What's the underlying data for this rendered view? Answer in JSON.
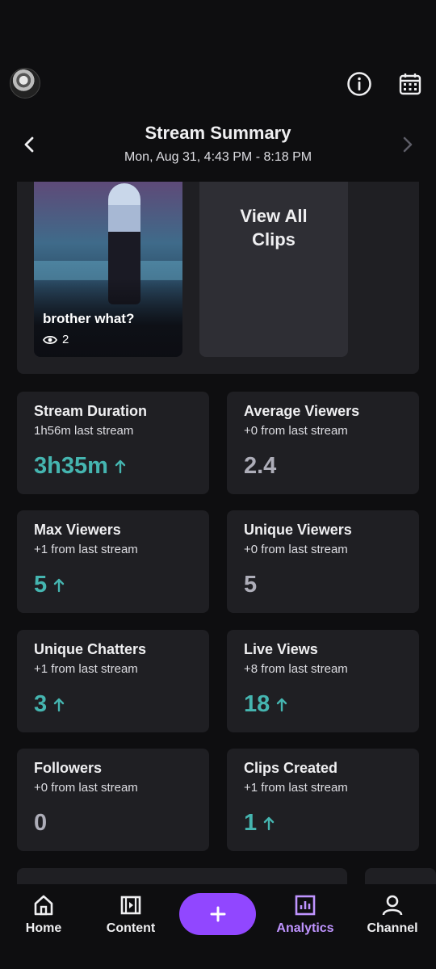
{
  "header": {
    "title": "Stream Summary",
    "subtitle": "Mon, Aug 31, 4:43 PM - 8:18 PM"
  },
  "clips": {
    "items": [
      {
        "title": "brother what?",
        "views": "2"
      }
    ],
    "view_all_label": "View All Clips"
  },
  "stats": [
    {
      "label": "Stream Duration",
      "sub": "1h56m last stream",
      "value": "3h35m",
      "trend": "up"
    },
    {
      "label": "Average Viewers",
      "sub": "+0 from last stream",
      "value": "2.4",
      "trend": "none"
    },
    {
      "label": "Max Viewers",
      "sub": "+1 from last stream",
      "value": "5",
      "trend": "up"
    },
    {
      "label": "Unique Viewers",
      "sub": "+0 from last stream",
      "value": "5",
      "trend": "none"
    },
    {
      "label": "Unique Chatters",
      "sub": "+1 from last stream",
      "value": "3",
      "trend": "up"
    },
    {
      "label": "Live Views",
      "sub": "+8 from last stream",
      "value": "18",
      "trend": "up"
    },
    {
      "label": "Followers",
      "sub": "+0 from last stream",
      "value": "0",
      "trend": "none"
    },
    {
      "label": "Clips Created",
      "sub": "+1 from last stream",
      "value": "1",
      "trend": "up"
    }
  ],
  "bottom_nav": {
    "items": [
      {
        "label": "Home",
        "icon": "home-icon"
      },
      {
        "label": "Content",
        "icon": "film-icon"
      },
      {
        "label": "Analytics",
        "icon": "analytics-icon",
        "active": true
      },
      {
        "label": "Channel",
        "icon": "person-icon"
      }
    ],
    "create_icon": "plus-icon"
  },
  "colors": {
    "background": "#0e0e10",
    "card": "#1f1f23",
    "accent_purple": "#9147ff",
    "active_nav": "#bf94ff",
    "trend_up": "#45b5b0",
    "neutral_value": "#adadb8"
  }
}
